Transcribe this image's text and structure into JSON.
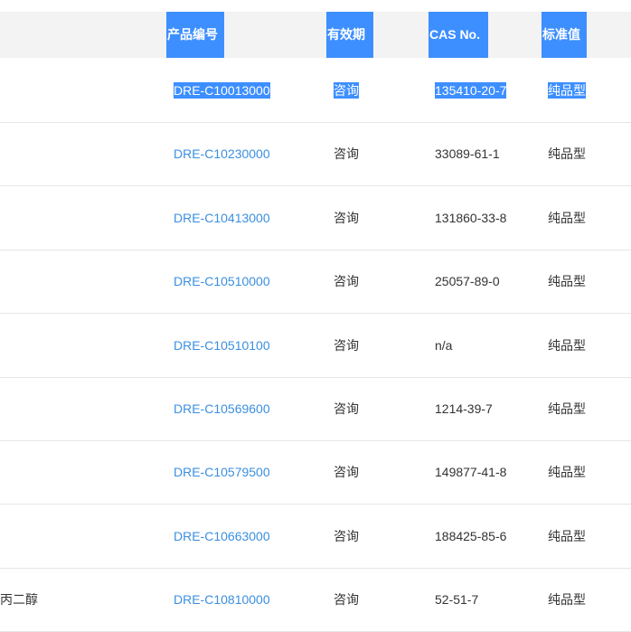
{
  "table": {
    "headers": {
      "code": "产品编号",
      "expiry": "有效期",
      "cas": "CAS No.",
      "standard": "标准值"
    },
    "rows": [
      {
        "name": "",
        "code": "DRE-C10013000",
        "expiry": "咨询",
        "cas": "135410-20-7",
        "standard": "纯品型",
        "selected": true
      },
      {
        "name": "",
        "code": "DRE-C10230000",
        "expiry": "咨询",
        "cas": "33089-61-1",
        "standard": "纯品型"
      },
      {
        "name": "",
        "code": "DRE-C10413000",
        "expiry": "咨询",
        "cas": "131860-33-8",
        "standard": "纯品型"
      },
      {
        "name": "",
        "code": "DRE-C10510000",
        "expiry": "咨询",
        "cas": "25057-89-0",
        "standard": "纯品型"
      },
      {
        "name": "",
        "code": "DRE-C10510100",
        "expiry": "咨询",
        "cas": "n/a",
        "standard": "纯品型"
      },
      {
        "name": "",
        "code": "DRE-C10569600",
        "expiry": "咨询",
        "cas": "1214-39-7",
        "standard": "纯品型"
      },
      {
        "name": "",
        "code": "DRE-C10579500",
        "expiry": "咨询",
        "cas": "149877-41-8",
        "standard": "纯品型"
      },
      {
        "name": "",
        "code": "DRE-C10663000",
        "expiry": "咨询",
        "cas": "188425-85-6",
        "standard": "纯品型"
      },
      {
        "name": "丙二醇",
        "code": "DRE-C10810000",
        "expiry": "咨询",
        "cas": "52-51-7",
        "standard": "纯品型"
      }
    ]
  },
  "colors": {
    "header_accent": "#3d8fff",
    "link": "#3b8fe0",
    "header_band": "#f3f3f3"
  }
}
